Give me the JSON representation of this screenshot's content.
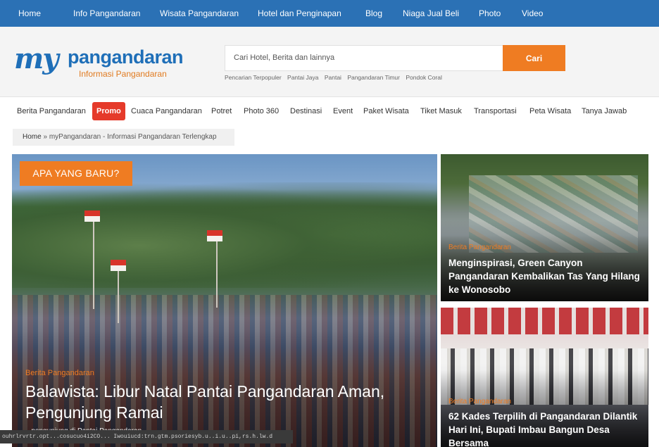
{
  "topnav": {
    "items": [
      "Home",
      "Info Pangandaran",
      "Wisata Pangandaran",
      "Hotel dan Penginapan",
      "Blog",
      "Niaga Jual Beli",
      "Photo",
      "Video"
    ]
  },
  "logo": {
    "my": "my",
    "name": "pangandaran",
    "tagline": "Informasi Pangandaran"
  },
  "search": {
    "placeholder": "Cari Hotel, Berita dan lainnya",
    "button": "Cari",
    "popular": [
      "Pencarian Terpopuler",
      "Pantai Jaya",
      "Pantai",
      "Pangandaran Timur",
      "Pondok Coral"
    ]
  },
  "categories": [
    "Berita Pangandaran",
    "Promo",
    "Cuaca Pangandaran",
    "Potret",
    "Photo 360",
    "Destinasi",
    "Event",
    "Paket Wisata",
    "Tiket Masuk",
    "Transportasi",
    "Peta Wisata",
    "Tanya Jawab"
  ],
  "breadcrumb": {
    "home": "Home",
    "separator": "»",
    "current": "myPangandaran - Informasi Pangandaran Terlengkap"
  },
  "hero": {
    "badge": "APA YANG BARU?",
    "tag": "Berita Pangandaran",
    "title": "Balawista: Libur Natal Pantai Pangandaran Aman, Pengunjung Ramai",
    "excerpt": "...pengunjung di Pantai Pangandaran"
  },
  "cards": [
    {
      "tag": "Berita Pangandaran",
      "title": "Menginspirasi, Green Canyon Pangandaran Kembalikan Tas Yang Hilang ke Wonosobo"
    },
    {
      "tag": "Berita Pangandaran",
      "title": "62 Kades Terpilih di Pangandaran Dilantik Hari Ini, Bupati Imbau Bangun Desa Bersama"
    }
  ],
  "statusbar": {
    "text": "ouhrlrvrtr.opt...cosucuo4i2CO... Iwouiucd:trn.gtm.psoriesyb.u..i.u..pi,rs.h.lw.d"
  },
  "colors": {
    "topnav": "#2b71b5",
    "accent": "#ef7c22",
    "promo": "#e53a2a"
  }
}
